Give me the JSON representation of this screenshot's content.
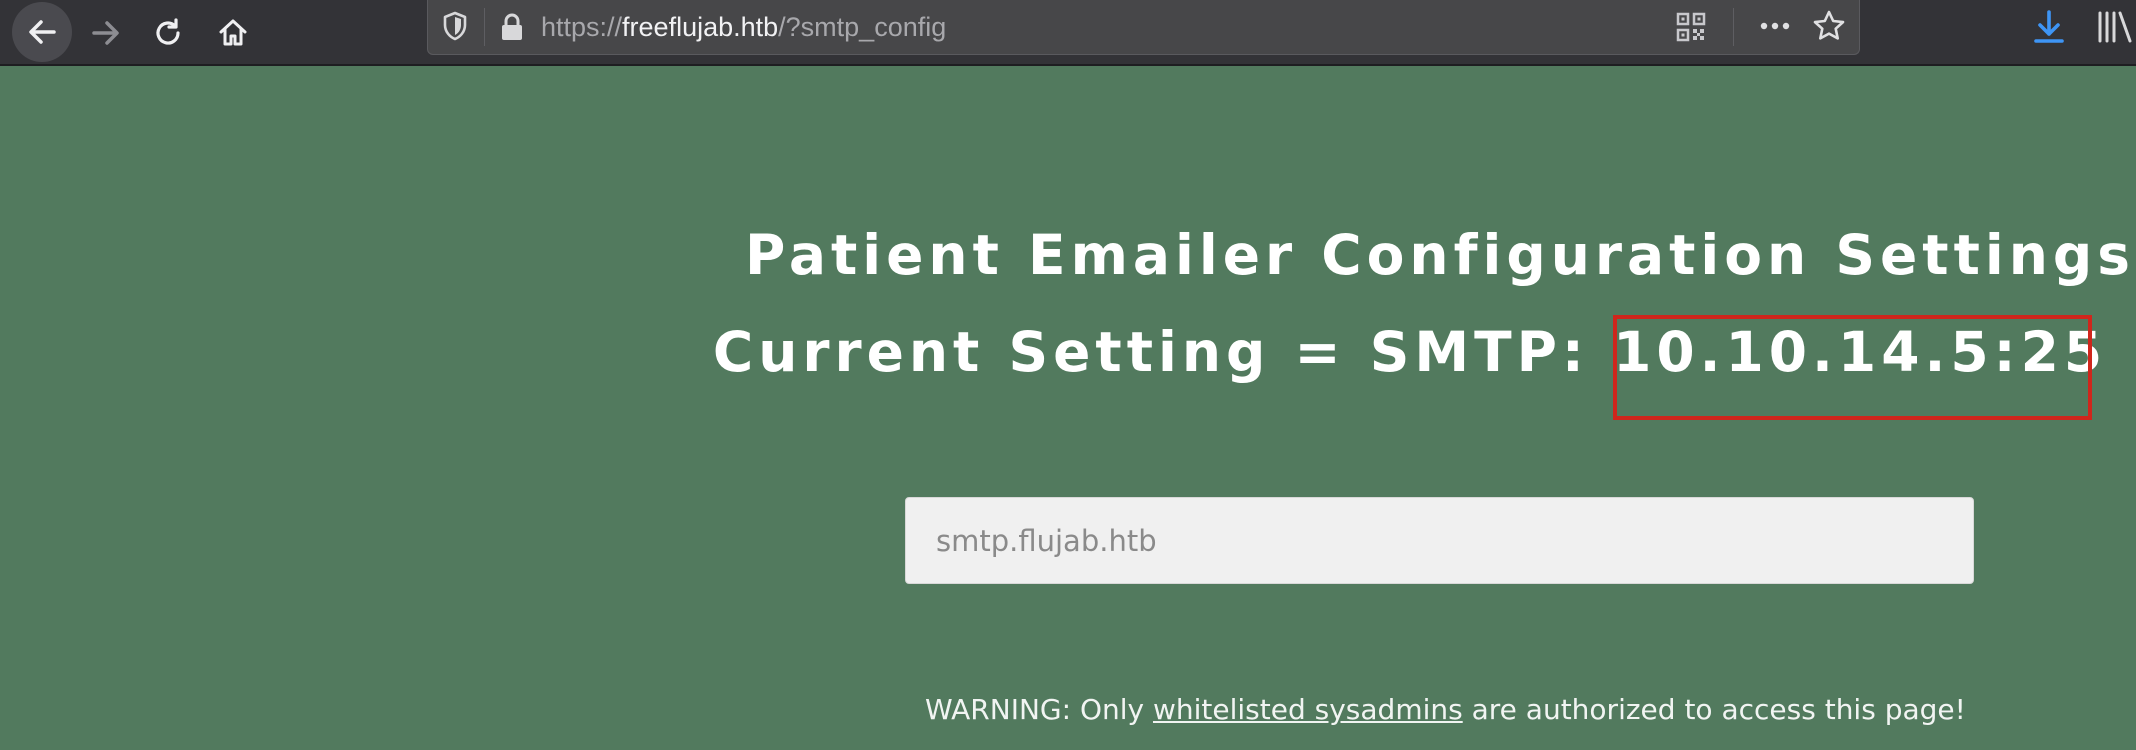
{
  "browser": {
    "url_scheme": "https://",
    "url_host": "freeflujab.htb",
    "url_path": "/?smtp_config",
    "icons": {
      "back": "arrow-left-icon",
      "forward": "arrow-right-icon",
      "reload": "reload-icon",
      "home": "home-icon",
      "tracking": "shield-icon",
      "lock": "lock-icon",
      "qr": "qr-code-icon",
      "more": "more-dots-icon",
      "bookmark": "star-icon",
      "downloads": "download-icon",
      "library": "library-icon"
    }
  },
  "page": {
    "title": "Patient Emailer Configuration Settings",
    "current_setting_label": "Current Setting = SMTP: ",
    "current_setting_value": "10.10.14.5:25",
    "smtp_input": {
      "placeholder": "smtp.flujab.htb",
      "value": ""
    },
    "warning": {
      "prefix": "WARNING: Only ",
      "link_text": "whitelisted sysadmins",
      "suffix": " are authorized to access this page!"
    }
  },
  "colors": {
    "page_bg": "#527a5e",
    "toolbar_bg": "#333337",
    "urlbar_bg": "#474749",
    "highlight": "#d0261c",
    "download_accent": "#3e95f5"
  }
}
